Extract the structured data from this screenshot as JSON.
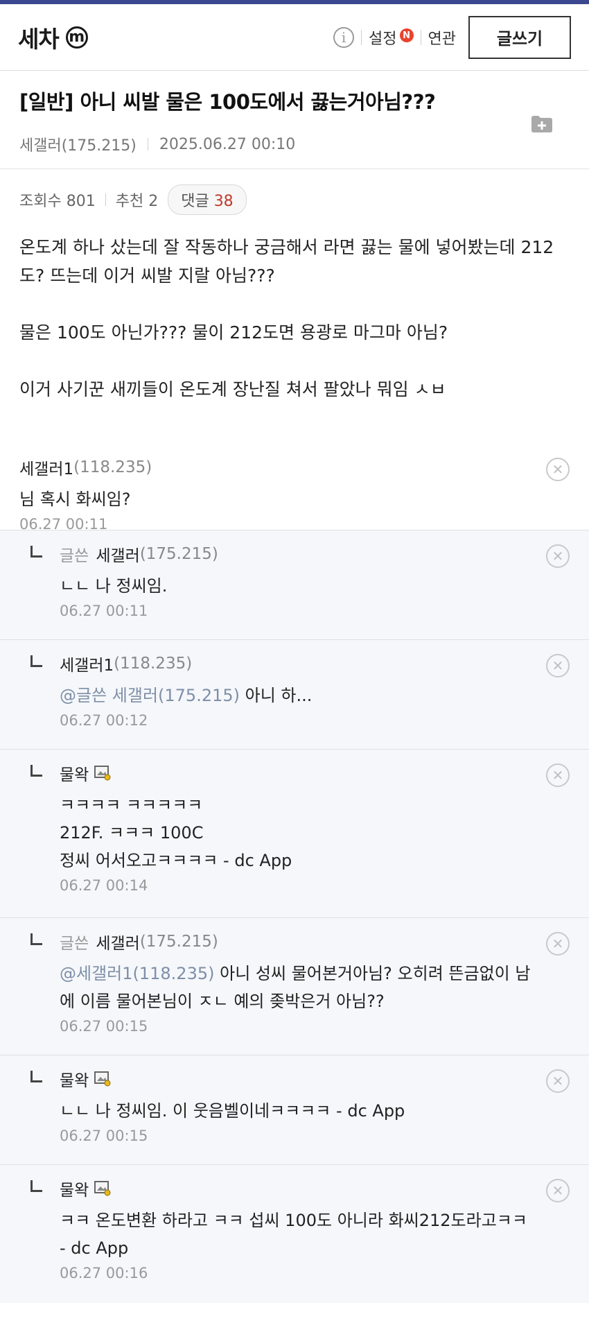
{
  "header": {
    "brand": "세차",
    "brand_badge": "m",
    "info_icon": "info-icon",
    "settings_label": "설정",
    "settings_badge": "N",
    "related_label": "연관",
    "write_label": "글쓰기"
  },
  "post": {
    "title": "[일반] 아니 씨발 물은 100도에서 끓는거아님???",
    "author": "세갤러(175.215)",
    "datetime": "2025.06.27 00:10",
    "views_label": "조회수 801",
    "recommend_label": "추천 2",
    "comment_label": "댓글",
    "comment_count": "38",
    "body": [
      "온도계 하나 샀는데 잘 작동하나 궁금해서 라면 끓는 물에 넣어봤는데 212도? 뜨는데 이거 씨발 지랄 아님???",
      "물은 100도 아닌가??? 물이 212도면 용광로 마그마 아님?",
      "이거 사기꾼 새끼들이 온도계 장난질 쳐서 팔았나 뭐임 ㅅㅂ"
    ]
  },
  "comments": [
    {
      "author_tag": "",
      "name": "세갤러1",
      "ip": "(118.235)",
      "mention": "",
      "lines": [
        "님 혹시 화씨임?"
      ],
      "date": "06.27 00:11"
    },
    {
      "author_tag": "글쓴",
      "name": "세갤러",
      "ip": "(175.215)",
      "mention": "",
      "lines": [
        "ㄴㄴ 나 정씨임."
      ],
      "date": "06.27 00:11"
    },
    {
      "author_tag": "",
      "name": "세갤러1",
      "ip": "(118.235)",
      "mention": "@글쓴 세갤러(175.215)",
      "lines": [
        " 아니 하..."
      ],
      "date": "06.27 00:12"
    },
    {
      "author_tag": "",
      "name": "물왁",
      "ip": "",
      "mention": "",
      "lines": [
        "ㅋㅋㅋㅋ ㅋㅋㅋㅋㅋ",
        "212F. ㅋㅋㅋ 100C",
        "정씨 어서오고ㅋㅋㅋㅋ - dc App"
      ],
      "date": "06.27 00:14"
    },
    {
      "author_tag": "글쓴",
      "name": "세갤러",
      "ip": "(175.215)",
      "mention": "@세갤러1(118.235)",
      "lines": [
        " 아니 성씨 물어본거아님? 오히려 뜬금없이 남에 이름 물어본님이 ㅈㄴ 예의 좆박은거 아님??"
      ],
      "date": "06.27 00:15"
    },
    {
      "author_tag": "",
      "name": "물왁",
      "ip": "",
      "mention": "",
      "lines": [
        "ㄴㄴ 나 정씨임. 이 웃음벨이네ㅋㅋㅋㅋ - dc App"
      ],
      "date": "06.27 00:15"
    },
    {
      "author_tag": "",
      "name": "물왁",
      "ip": "",
      "mention": "",
      "lines": [
        "ㅋㅋ 온도변환 하라고 ㅋㅋ 섭씨 100도 아니라 화씨212도라고ㅋㅋ - dc App"
      ],
      "date": "06.27 00:16"
    }
  ]
}
